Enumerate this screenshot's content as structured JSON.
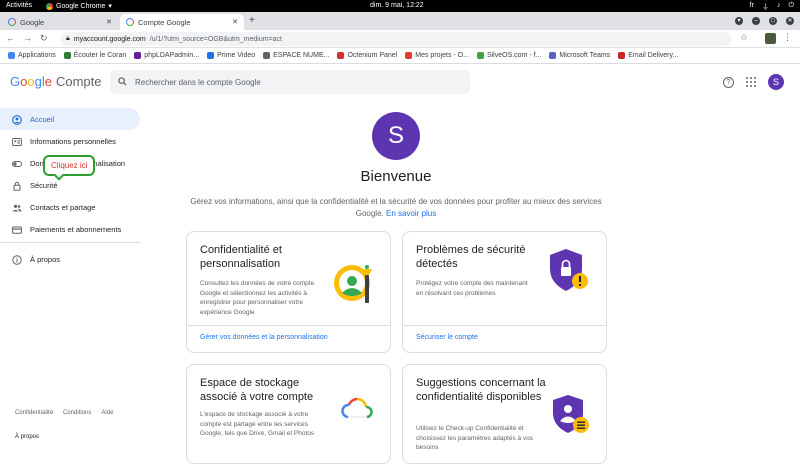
{
  "os": {
    "activities": "Activités",
    "app": "Google Chrome",
    "clock": "dim.  9 mai, 12:22",
    "lang": "fr"
  },
  "tabs": [
    {
      "label": "Google"
    },
    {
      "label": "Compte Google"
    }
  ],
  "address": {
    "host": "myaccount.google.com",
    "path": "/u/1/?utm_source=OGB&utm_medium=act"
  },
  "bookmarks": [
    {
      "label": "Applications",
      "color": "#4285f4"
    },
    {
      "label": "Écouter le Coran",
      "color": "#2e7d32"
    },
    {
      "label": "phpLDAPadmin...",
      "color": "#6a1b9a"
    },
    {
      "label": "Prime Video",
      "color": "#1a73e8"
    },
    {
      "label": "ESPACE NUME...",
      "color": "#5f6368"
    },
    {
      "label": "Octenium Panel",
      "color": "#d32f2f"
    },
    {
      "label": "Mes projets - O...",
      "color": "#e53935"
    },
    {
      "label": "SilveOS.com - f...",
      "color": "#43a047"
    },
    {
      "label": "Microsoft Teams",
      "color": "#5b5fc7"
    },
    {
      "label": "Email Delivery...",
      "color": "#c62828"
    }
  ],
  "header": {
    "logo_google": "Google",
    "logo_compte": "Compte",
    "search_placeholder": "Rechercher dans le compte Google",
    "avatar": "S"
  },
  "sidebar": {
    "items": [
      {
        "label": "Accueil",
        "icon": "home-icon"
      },
      {
        "label": "Informations personnelles",
        "icon": "id-card-icon"
      },
      {
        "label": "Données et personnalisation",
        "icon": "toggle-icon"
      },
      {
        "label": "Sécurité",
        "icon": "lock-icon"
      },
      {
        "label": "Contacts et partage",
        "icon": "people-icon"
      },
      {
        "label": "Paiements et abonnements",
        "icon": "card-icon"
      },
      {
        "label": "À propos",
        "icon": "info-icon"
      }
    ],
    "tooltip": "Cliquez ici",
    "footer": [
      "Confidentialité",
      "Conditions",
      "Aide"
    ],
    "apropos": "À propos"
  },
  "main": {
    "avatar": "S",
    "welcome": "Bienvenue",
    "intro": "Gérez vos informations, ainsi que la confidentialité et la sécurité de vos données pour profiter au mieux des services Google.",
    "intro_link": "En savoir plus",
    "cards": [
      {
        "title": "Confidentialité et personnalisation",
        "text": "Consultez les données de votre compte Google et sélectionnez les activités à enregistrer pour personnaliser votre expérience Google",
        "link": "Gérer vos données et la personnalisation"
      },
      {
        "title": "Problèmes de sécurité détectés",
        "text": "Protégez votre compte des maintenant en résolvant ces problèmes",
        "link": "Sécuriser le compte"
      },
      {
        "title": "Espace de stockage associé à votre compte",
        "text": "L'espace de stockage associé à votre compte est partagé entre les services Google, tels que Drive, Gmail et Photos",
        "link": ""
      },
      {
        "title": "Suggestions concernant la confidentialité disponibles",
        "text": "Utilisez le Check-up Confidentialité et choisissez les paramètres adaptés à vos besoins",
        "link": ""
      }
    ]
  }
}
